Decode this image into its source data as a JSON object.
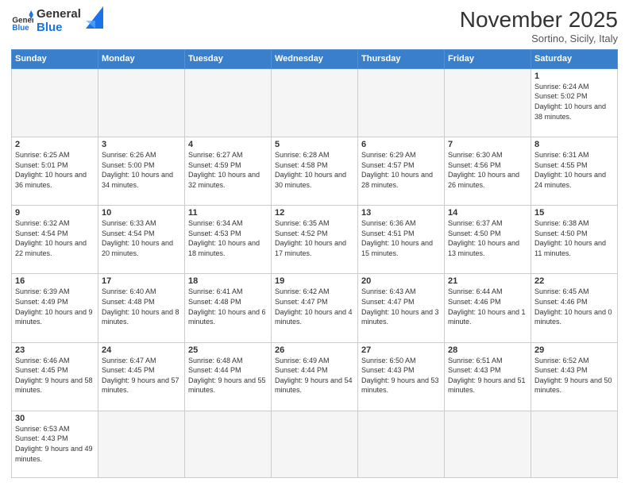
{
  "header": {
    "logo_general": "General",
    "logo_blue": "Blue",
    "title": "November 2025",
    "location": "Sortino, Sicily, Italy"
  },
  "days_of_week": [
    "Sunday",
    "Monday",
    "Tuesday",
    "Wednesday",
    "Thursday",
    "Friday",
    "Saturday"
  ],
  "weeks": [
    [
      {
        "day": "",
        "info": ""
      },
      {
        "day": "",
        "info": ""
      },
      {
        "day": "",
        "info": ""
      },
      {
        "day": "",
        "info": ""
      },
      {
        "day": "",
        "info": ""
      },
      {
        "day": "",
        "info": ""
      },
      {
        "day": "1",
        "info": "Sunrise: 6:24 AM\nSunset: 5:02 PM\nDaylight: 10 hours and 38 minutes."
      }
    ],
    [
      {
        "day": "2",
        "info": "Sunrise: 6:25 AM\nSunset: 5:01 PM\nDaylight: 10 hours and 36 minutes."
      },
      {
        "day": "3",
        "info": "Sunrise: 6:26 AM\nSunset: 5:00 PM\nDaylight: 10 hours and 34 minutes."
      },
      {
        "day": "4",
        "info": "Sunrise: 6:27 AM\nSunset: 4:59 PM\nDaylight: 10 hours and 32 minutes."
      },
      {
        "day": "5",
        "info": "Sunrise: 6:28 AM\nSunset: 4:58 PM\nDaylight: 10 hours and 30 minutes."
      },
      {
        "day": "6",
        "info": "Sunrise: 6:29 AM\nSunset: 4:57 PM\nDaylight: 10 hours and 28 minutes."
      },
      {
        "day": "7",
        "info": "Sunrise: 6:30 AM\nSunset: 4:56 PM\nDaylight: 10 hours and 26 minutes."
      },
      {
        "day": "8",
        "info": "Sunrise: 6:31 AM\nSunset: 4:55 PM\nDaylight: 10 hours and 24 minutes."
      }
    ],
    [
      {
        "day": "9",
        "info": "Sunrise: 6:32 AM\nSunset: 4:54 PM\nDaylight: 10 hours and 22 minutes."
      },
      {
        "day": "10",
        "info": "Sunrise: 6:33 AM\nSunset: 4:54 PM\nDaylight: 10 hours and 20 minutes."
      },
      {
        "day": "11",
        "info": "Sunrise: 6:34 AM\nSunset: 4:53 PM\nDaylight: 10 hours and 18 minutes."
      },
      {
        "day": "12",
        "info": "Sunrise: 6:35 AM\nSunset: 4:52 PM\nDaylight: 10 hours and 17 minutes."
      },
      {
        "day": "13",
        "info": "Sunrise: 6:36 AM\nSunset: 4:51 PM\nDaylight: 10 hours and 15 minutes."
      },
      {
        "day": "14",
        "info": "Sunrise: 6:37 AM\nSunset: 4:50 PM\nDaylight: 10 hours and 13 minutes."
      },
      {
        "day": "15",
        "info": "Sunrise: 6:38 AM\nSunset: 4:50 PM\nDaylight: 10 hours and 11 minutes."
      }
    ],
    [
      {
        "day": "16",
        "info": "Sunrise: 6:39 AM\nSunset: 4:49 PM\nDaylight: 10 hours and 9 minutes."
      },
      {
        "day": "17",
        "info": "Sunrise: 6:40 AM\nSunset: 4:48 PM\nDaylight: 10 hours and 8 minutes."
      },
      {
        "day": "18",
        "info": "Sunrise: 6:41 AM\nSunset: 4:48 PM\nDaylight: 10 hours and 6 minutes."
      },
      {
        "day": "19",
        "info": "Sunrise: 6:42 AM\nSunset: 4:47 PM\nDaylight: 10 hours and 4 minutes."
      },
      {
        "day": "20",
        "info": "Sunrise: 6:43 AM\nSunset: 4:47 PM\nDaylight: 10 hours and 3 minutes."
      },
      {
        "day": "21",
        "info": "Sunrise: 6:44 AM\nSunset: 4:46 PM\nDaylight: 10 hours and 1 minute."
      },
      {
        "day": "22",
        "info": "Sunrise: 6:45 AM\nSunset: 4:46 PM\nDaylight: 10 hours and 0 minutes."
      }
    ],
    [
      {
        "day": "23",
        "info": "Sunrise: 6:46 AM\nSunset: 4:45 PM\nDaylight: 9 hours and 58 minutes."
      },
      {
        "day": "24",
        "info": "Sunrise: 6:47 AM\nSunset: 4:45 PM\nDaylight: 9 hours and 57 minutes."
      },
      {
        "day": "25",
        "info": "Sunrise: 6:48 AM\nSunset: 4:44 PM\nDaylight: 9 hours and 55 minutes."
      },
      {
        "day": "26",
        "info": "Sunrise: 6:49 AM\nSunset: 4:44 PM\nDaylight: 9 hours and 54 minutes."
      },
      {
        "day": "27",
        "info": "Sunrise: 6:50 AM\nSunset: 4:43 PM\nDaylight: 9 hours and 53 minutes."
      },
      {
        "day": "28",
        "info": "Sunrise: 6:51 AM\nSunset: 4:43 PM\nDaylight: 9 hours and 51 minutes."
      },
      {
        "day": "29",
        "info": "Sunrise: 6:52 AM\nSunset: 4:43 PM\nDaylight: 9 hours and 50 minutes."
      }
    ],
    [
      {
        "day": "30",
        "info": "Sunrise: 6:53 AM\nSunset: 4:43 PM\nDaylight: 9 hours and 49 minutes."
      },
      {
        "day": "",
        "info": ""
      },
      {
        "day": "",
        "info": ""
      },
      {
        "day": "",
        "info": ""
      },
      {
        "day": "",
        "info": ""
      },
      {
        "day": "",
        "info": ""
      },
      {
        "day": "",
        "info": ""
      }
    ]
  ]
}
